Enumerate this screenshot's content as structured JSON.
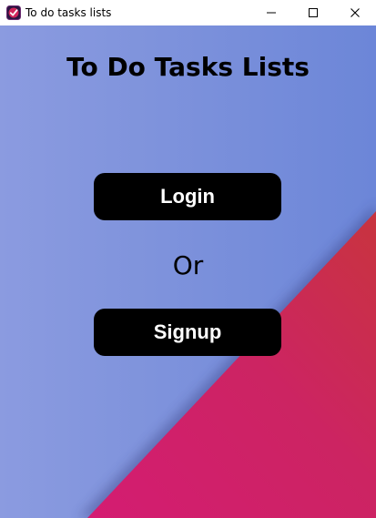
{
  "window": {
    "title": "To do tasks lists",
    "icon": "todo-check-icon",
    "controls": [
      "minimize-icon",
      "maximize-icon",
      "close-icon"
    ]
  },
  "main": {
    "title": "To Do Tasks Lists",
    "login_label": "Login",
    "or_label": "Or",
    "signup_label": "Signup"
  },
  "colors": {
    "background_blue": "#7f93dc",
    "background_red": "#c8245e",
    "button": "#000000",
    "button_text": "#ffffff"
  }
}
